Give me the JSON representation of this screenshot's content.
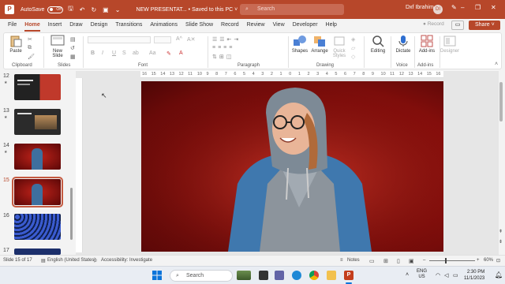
{
  "titlebar": {
    "autosave_label": "AutoSave",
    "autosave_state": "Off",
    "doc_title": "NEW PRESENTAT... • Saved to this PC ˅",
    "search_placeholder": "Search",
    "user_name": "Dxf Ibrahim",
    "user_initials": "DI",
    "minimize": "–",
    "restore": "❐",
    "close": "✕"
  },
  "tabs": [
    "File",
    "Home",
    "Insert",
    "Draw",
    "Design",
    "Transitions",
    "Animations",
    "Slide Show",
    "Record",
    "Review",
    "View",
    "Developer",
    "Help"
  ],
  "active_tab": "Home",
  "tab_actions": {
    "record": "Record",
    "share": "Share"
  },
  "ribbon": {
    "clipboard": {
      "paste": "Paste",
      "label": "Clipboard"
    },
    "slides": {
      "new_slide": "New Slide",
      "label": "Slides"
    },
    "font": {
      "label": "Font",
      "bold": "B",
      "italic": "I",
      "underline": "U",
      "strike": "S"
    },
    "paragraph": {
      "label": "Paragraph"
    },
    "drawing": {
      "shapes": "Shapes",
      "arrange": "Arrange",
      "quick_styles": "Quick Styles",
      "label": "Drawing"
    },
    "editing": {
      "label": "Editing"
    },
    "voice": {
      "dictate": "Dictate",
      "label": "Voice"
    },
    "addins": {
      "addins": "Add-ins",
      "label": "Add-ins"
    },
    "designer": {
      "label": "Designer"
    }
  },
  "slides": [
    {
      "num": "12",
      "star": true
    },
    {
      "num": "13",
      "star": true
    },
    {
      "num": "14",
      "star": true
    },
    {
      "num": "15",
      "star": false
    },
    {
      "num": "16",
      "star": false
    },
    {
      "num": "17",
      "star": false
    }
  ],
  "current_slide": "15",
  "ruler_ticks": [
    "16",
    "15",
    "14",
    "13",
    "12",
    "11",
    "10",
    "9",
    "8",
    "7",
    "6",
    "5",
    "4",
    "3",
    "2",
    "1",
    "0",
    "1",
    "2",
    "3",
    "4",
    "5",
    "6",
    "7",
    "8",
    "9",
    "10",
    "11",
    "12",
    "13",
    "14",
    "15",
    "16"
  ],
  "status": {
    "slide_info": "Slide 15 of 17",
    "language": "English (United States)",
    "accessibility": "Accessibility: Investigate",
    "notes": "Notes",
    "zoom": "60%"
  },
  "taskbar": {
    "search_placeholder": "Search",
    "lang_line1": "ENG",
    "lang_line2": "US",
    "time": "2:30 PM",
    "date": "11/1/2023"
  },
  "colors": {
    "accent": "#b7472a",
    "slide_bg": "#8a0f0c"
  }
}
